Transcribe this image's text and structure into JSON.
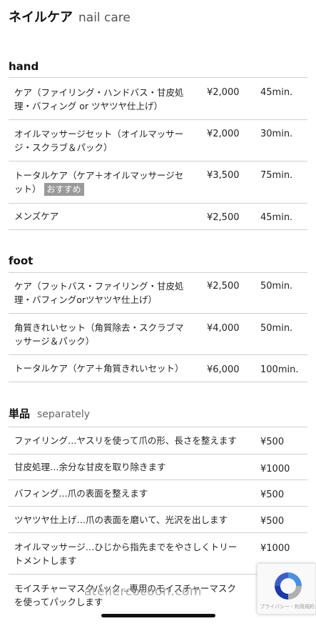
{
  "header": {
    "title_jp": "ネイルケア",
    "title_en": "nail care"
  },
  "hand": {
    "title": "hand",
    "rows": [
      {
        "lines": [
          "ケア（ファイリング・ハンドバス・甘皮処",
          "理・バフィング or ツヤツヤ仕上げ）"
        ],
        "price": "¥2,000",
        "time": "45min."
      },
      {
        "lines": [
          "オイルマッサージセット（オイルマッサー",
          "ジ・スクラブ＆パック）"
        ],
        "price": "¥2,000",
        "time": "30min."
      },
      {
        "lines": [
          "トータルケア（ケア＋オイルマッサージセ",
          "ット）"
        ],
        "badge": "おすすめ",
        "price": "¥3,500",
        "time": "75min."
      },
      {
        "lines": [
          "メンズケア"
        ],
        "price": "¥2,500",
        "time": "45min."
      }
    ]
  },
  "foot": {
    "title": "foot",
    "rows": [
      {
        "lines": [
          "ケア（フットバス・ファイリング・甘皮処",
          "理・バフィングorツヤツヤ仕上げ）"
        ],
        "price": "¥2,500",
        "time": "50min."
      },
      {
        "lines": [
          "角質きれいセット（角質除去・スクラブマ",
          "ッサージ＆パック）"
        ],
        "price": "¥4,000",
        "time": "50min."
      },
      {
        "lines": [
          "トータルケア（ケア＋角質きれいセット）"
        ],
        "price": "¥6,000",
        "time": "100min."
      }
    ]
  },
  "single": {
    "title_jp": "単品",
    "title_en": "separately",
    "rows": [
      {
        "lines": [
          "ファイリング…ヤスリを使って爪の形、長さを整えます"
        ],
        "price": "¥500"
      },
      {
        "lines": [
          "甘皮処理…余分な甘皮を取り除きます"
        ],
        "price": "¥1000"
      },
      {
        "lines": [
          "バフィング…爪の表面を整えます"
        ],
        "price": "¥500"
      },
      {
        "lines": [
          "ツヤツヤ仕上げ…爪の表面を磨いて、光沢を出します"
        ],
        "price": "¥500"
      },
      {
        "lines": [
          "オイルマッサージ…ひじから指先までをやさしくトリー",
          "トメントします"
        ],
        "price": "¥1000"
      },
      {
        "lines": [
          "モイスチャーマスクパック…専用のモイスチャーマスク",
          "を使ってパックします"
        ],
        "price": ""
      }
    ]
  },
  "watermark": "ateliercocoon.com",
  "recaptcha": {
    "text": "プライバシー - 利用規約"
  }
}
